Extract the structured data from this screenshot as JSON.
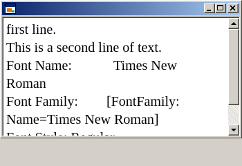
{
  "window": {
    "title": "",
    "buttons": {
      "minimize": "minimize-icon",
      "maximize": "maximize-icon",
      "close": "close-icon"
    },
    "colors": {
      "title_active": "#0a246a",
      "title_gradient_end": "#a6caf0",
      "face": "#d4d0c8"
    }
  },
  "content": {
    "line1": "first line.",
    "line2": "This is a second line of text.",
    "font_name_label": "Font Name:",
    "font_name_value_1": "Times New",
    "font_name_value_2": "Roman",
    "font_family_label": "Font Family:",
    "font_family_value_1": "[FontFamily:",
    "font_family_value_2": "Name=Times New Roman]",
    "font_style_partial": "Font Style:    Regular"
  }
}
